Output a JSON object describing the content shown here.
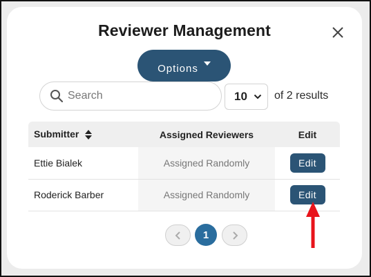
{
  "modal": {
    "title": "Reviewer Management",
    "options_label": "Options"
  },
  "search": {
    "placeholder": "Search",
    "value": ""
  },
  "page_size": {
    "selected": "10"
  },
  "results_text": "of 2 results",
  "table": {
    "headers": [
      "Submitter",
      "Assigned Reviewers",
      "Edit"
    ],
    "rows": [
      {
        "submitter": "Ettie Bialek",
        "reviewers": "Assigned Randomly",
        "action": "Edit"
      },
      {
        "submitter": "Roderick Barber",
        "reviewers": "Assigned Randomly",
        "action": "Edit"
      }
    ]
  },
  "pagination": {
    "current_page": "1"
  },
  "colors": {
    "primary": "#2b5475",
    "page_active": "#2a6d9e",
    "annotation_arrow": "#e8141b"
  },
  "icons": [
    "close-icon",
    "caret-down-icon",
    "search-icon",
    "chevron-down-icon",
    "sort-icon",
    "chevron-left-icon",
    "chevron-right-icon"
  ]
}
